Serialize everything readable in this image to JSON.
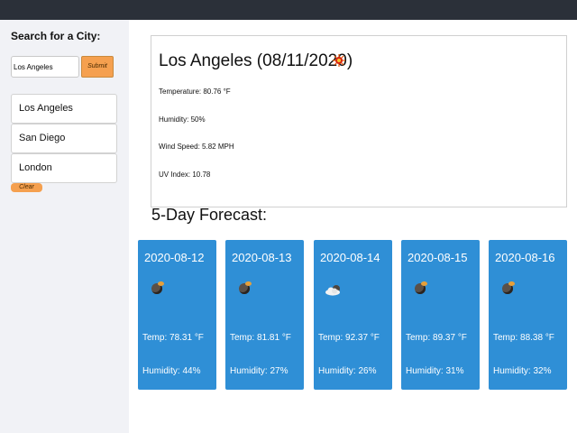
{
  "sidebar": {
    "search_title": "Search for a City:",
    "input_value": "Los Angeles",
    "submit_label": "Submit",
    "history": [
      "Los Angeles",
      "San Diego",
      "London"
    ],
    "clear_label": "Clear"
  },
  "current": {
    "title": "Los Angeles (08/11/2020)",
    "icon": "sun-icon",
    "temperature": "Temperature: 80.76 °F",
    "humidity": "Humidity: 50%",
    "wind": "Wind Speed: 5.82 MPH",
    "uv": "UV Index: 10.78"
  },
  "forecast": {
    "title": "5-Day Forecast:",
    "days": [
      {
        "date": "2020-08-12",
        "icon": "night-icon",
        "temp": "Temp: 78.31 °F",
        "humidity": "Humidity: 44%"
      },
      {
        "date": "2020-08-13",
        "icon": "night-icon",
        "temp": "Temp: 81.81 °F",
        "humidity": "Humidity: 27%"
      },
      {
        "date": "2020-08-14",
        "icon": "cloudy-night-icon",
        "temp": "Temp: 92.37 °F",
        "humidity": "Humidity: 26%"
      },
      {
        "date": "2020-08-15",
        "icon": "night-icon",
        "temp": "Temp: 89.37 °F",
        "humidity": "Humidity: 31%"
      },
      {
        "date": "2020-08-16",
        "icon": "night-icon",
        "temp": "Temp: 88.38 °F",
        "humidity": "Humidity: 32%"
      }
    ]
  },
  "colors": {
    "topbar": "#2b3039",
    "sidebar": "#f1f2f6",
    "accent": "#f5a04f",
    "card": "#2f8fd6"
  }
}
